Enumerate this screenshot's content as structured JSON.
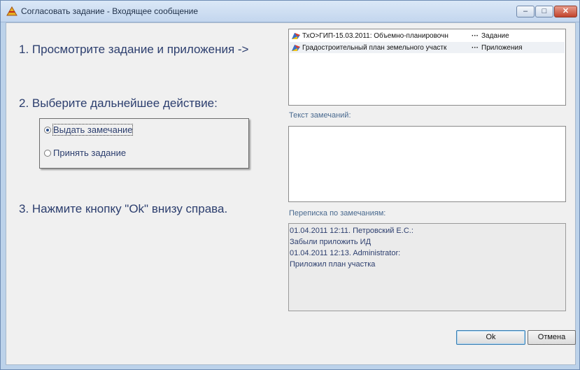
{
  "window": {
    "title": "Согласовать задание - Входящее сообщение",
    "controls": {
      "minimize": "–",
      "maximize": "□",
      "close": "✕"
    }
  },
  "steps": {
    "step1": "1. Просмотрите задание и приложения ->",
    "step2": "2. Выберите дальнейшее действие:",
    "step3": "3. Нажмите кнопку \"Ok\" внизу справа."
  },
  "radio_options": [
    {
      "label": "Выдать замечание",
      "selected": true
    },
    {
      "label": "Принять задание",
      "selected": false
    }
  ],
  "attachments": [
    {
      "name": "ТхО>ГИП-15.03.2011: Объемно-планировочн",
      "more": "···",
      "type": "Задание",
      "icon": "document-icon"
    },
    {
      "name": "Градостроительный план земельного участк",
      "more": "···",
      "type": "Приложения",
      "icon": "document-icon"
    }
  ],
  "remarks": {
    "label": "Текст замечаний:",
    "value": ""
  },
  "correspondence": {
    "label": "Переписка по замечаниям:",
    "lines": [
      "01.04.2011 12:11. Петровский Е.С.:",
      "Забыли приложить ИД",
      "01.04.2011 12:13. Administrator:",
      "Приложил план участка"
    ]
  },
  "buttons": {
    "ok": "Ok",
    "cancel": "Отмена"
  },
  "colors": {
    "accent_text": "#2c3e6e",
    "titlebar": "#c3d6ee",
    "close_button": "#c2432c"
  }
}
